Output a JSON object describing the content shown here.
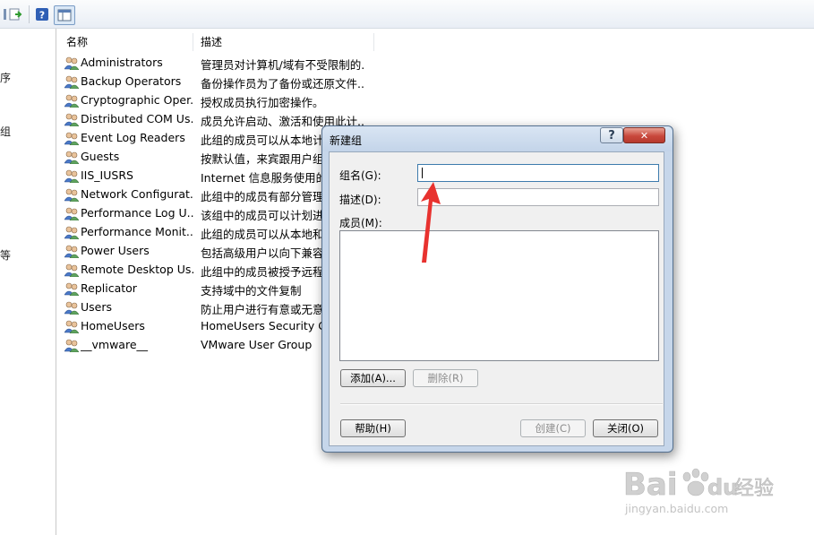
{
  "left_pane": {
    "fragments": [
      "序",
      "组",
      "等"
    ]
  },
  "columns": {
    "name": "名称",
    "desc": "描述"
  },
  "groups": [
    {
      "name": "Administrators",
      "desc": "管理员对计算机/域有不受限制的..."
    },
    {
      "name": "Backup Operators",
      "desc": "备份操作员为了备份或还原文件..."
    },
    {
      "name": "Cryptographic Oper...",
      "desc": "授权成员执行加密操作。"
    },
    {
      "name": "Distributed COM Us...",
      "desc": "成员允许启动、激活和使用此计..."
    },
    {
      "name": "Event Log Readers",
      "desc": "此组的成员可以从本地计算机..."
    },
    {
      "name": "Guests",
      "desc": "按默认值，来宾跟用户组的成员..."
    },
    {
      "name": "IIS_IUSRS",
      "desc": "Internet 信息服务使用的内置组..."
    },
    {
      "name": "Network Configurat...",
      "desc": "此组中的成员有部分管理权限..."
    },
    {
      "name": "Performance Log U...",
      "desc": "该组中的成员可以计划进行性..."
    },
    {
      "name": "Performance Monit...",
      "desc": "此组的成员可以从本地和远程..."
    },
    {
      "name": "Power Users",
      "desc": "包括高级用户以向下兼容..."
    },
    {
      "name": "Remote Desktop Us...",
      "desc": "此组中的成员被授予远程登录..."
    },
    {
      "name": "Replicator",
      "desc": "支持域中的文件复制"
    },
    {
      "name": "Users",
      "desc": "防止用户进行有意或无意的..."
    },
    {
      "name": "HomeUsers",
      "desc": "HomeUsers Security Group"
    },
    {
      "name": "__vmware__",
      "desc": "VMware User Group"
    }
  ],
  "dialog": {
    "title": "新建组",
    "help_glyph": "?",
    "close_glyph": "✕",
    "group_name_label": "组名(G):",
    "group_name_value": "",
    "description_label": "描述(D):",
    "description_value": "",
    "members_label": "成员(M):",
    "add_label": "添加(A)...",
    "remove_label": "删除(R)",
    "help_label": "帮助(H)",
    "create_label": "创建(C)",
    "close_label": "关闭(O)"
  },
  "watermark": {
    "brand": "Bai",
    "brand2": "du",
    "suffix": "经验",
    "url": "jingyan.baidu.com"
  },
  "colors": {
    "arrow": "#e8322f",
    "dialog_frame": "#c6d6ea",
    "close_button": "#c9483c"
  }
}
